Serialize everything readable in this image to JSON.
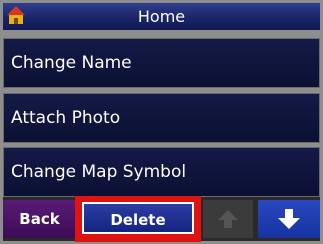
{
  "header": {
    "title": "Home",
    "icon": "home-icon"
  },
  "menu": {
    "items": [
      {
        "label": "Change Name"
      },
      {
        "label": "Attach Photo"
      },
      {
        "label": "Change Map Symbol"
      }
    ]
  },
  "footer": {
    "back_label": "Back",
    "delete_label": "Delete",
    "up_icon": "arrow-up-icon",
    "down_icon": "arrow-down-icon"
  },
  "colors": {
    "highlight_border": "#e01313",
    "accent": "#1a2467"
  }
}
